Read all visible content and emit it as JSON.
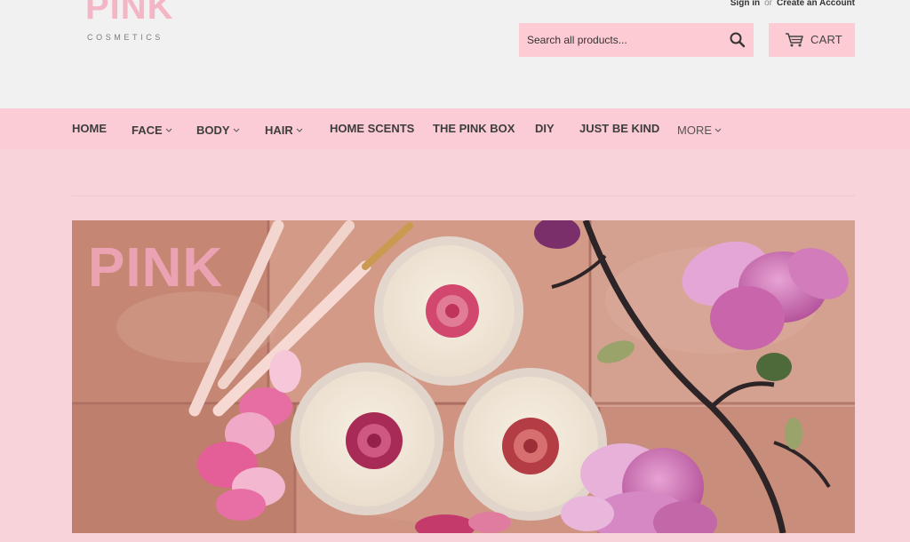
{
  "brand": {
    "logo_text": "PINK",
    "logo_subtext": "COSMETICS",
    "accent_color": "#fccbd4",
    "nav_color": "#fcccd6",
    "page_color": "#f8d4da"
  },
  "account": {
    "sign_in": "Sign in",
    "separator": "or",
    "create_account": "Create an Account"
  },
  "search": {
    "placeholder": "Search all products...",
    "icon": "search-icon"
  },
  "cart": {
    "label": "CART",
    "icon": "cart-icon"
  },
  "nav": {
    "items": [
      {
        "label": "HOME",
        "has_dropdown": false
      },
      {
        "label": "FACE",
        "has_dropdown": true
      },
      {
        "label": "BODY",
        "has_dropdown": true
      },
      {
        "label": "HAIR",
        "has_dropdown": true
      },
      {
        "label": "HOME SCENTS",
        "has_dropdown": false
      },
      {
        "label": "THE PINK BOX",
        "has_dropdown": false
      },
      {
        "label": "DIY",
        "has_dropdown": false
      },
      {
        "label": "JUST BE KIND",
        "has_dropdown": false
      },
      {
        "label": "MORE",
        "has_dropdown": true
      }
    ]
  },
  "hero": {
    "watermark_text": "PINK"
  }
}
